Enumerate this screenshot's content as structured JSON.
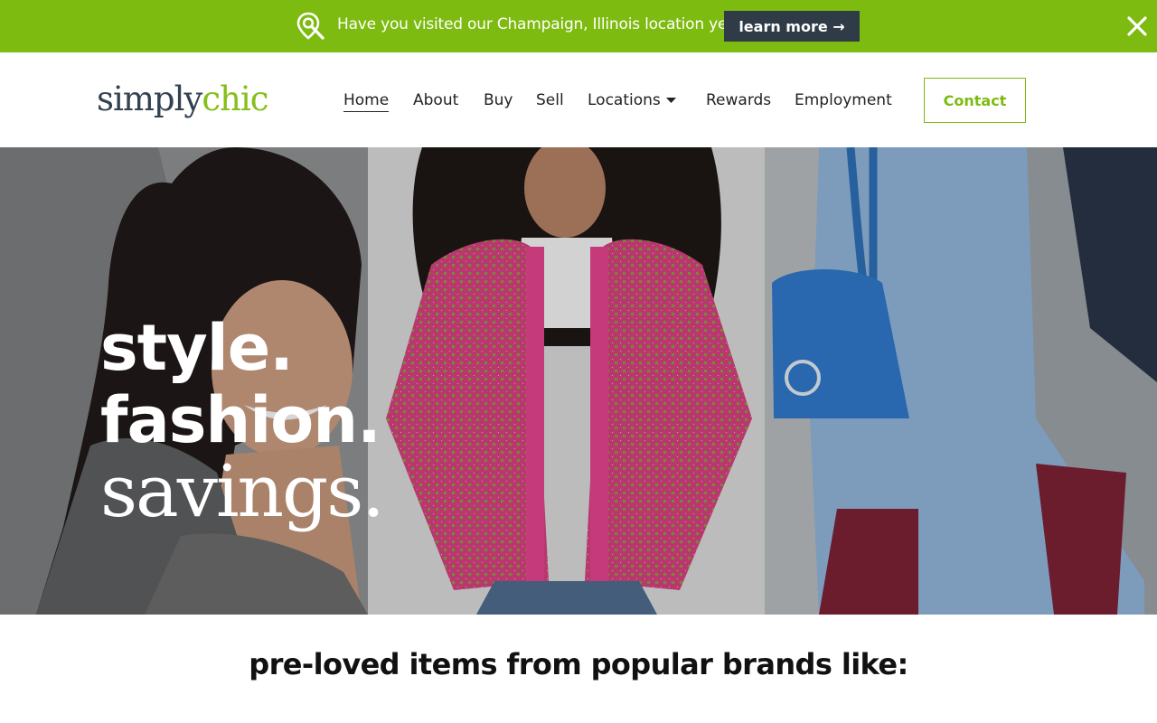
{
  "announcement": {
    "icon": "map-search-icon",
    "message": "Have you visited our Champaign, Illinois location yet?",
    "button_label": "learn more →",
    "close_icon": "close-icon",
    "background_color": "#7dbb10",
    "button_color": "#2f3b46"
  },
  "brand": {
    "logo_part1": "simply",
    "logo_part2": "chic",
    "logo_colors": [
      "#344150",
      "#85bf1a"
    ]
  },
  "nav": {
    "items": [
      {
        "label": "Home",
        "active": true
      },
      {
        "label": "About"
      },
      {
        "label": "Buy"
      },
      {
        "label": "Sell"
      },
      {
        "label": "Locations",
        "icon": "caret-down-icon"
      },
      {
        "label": "Rewards"
      },
      {
        "label": "Employment"
      }
    ],
    "contact_label": "Contact",
    "accent_color": "#7dbb10"
  },
  "hero": {
    "line1": "style.",
    "line2": "fashion.",
    "line3": "savings."
  },
  "brands": {
    "heading": "pre-loved items from popular brands like:"
  }
}
